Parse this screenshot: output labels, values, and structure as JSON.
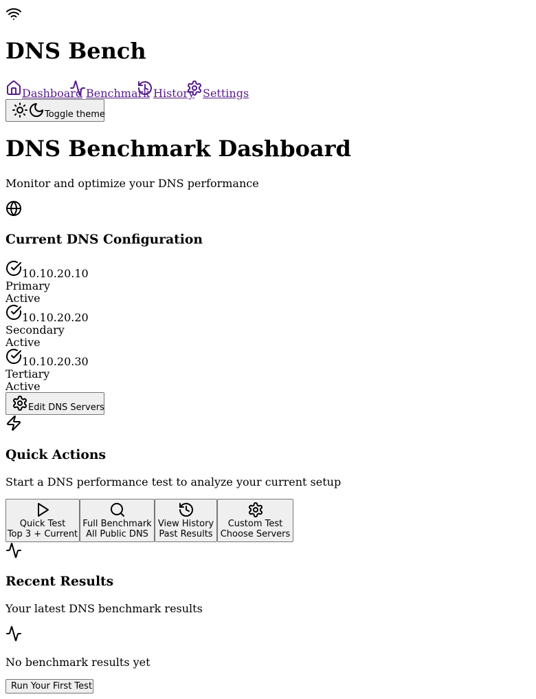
{
  "header": {
    "wifi_icon": "wifi-icon",
    "app_title": "DNS Bench",
    "nav": [
      {
        "label": "Dashboard",
        "icon": "home-icon"
      },
      {
        "label": "Benchmark",
        "icon": "activity-icon"
      },
      {
        "label": "History",
        "icon": "history-icon"
      },
      {
        "label": "Settings",
        "icon": "settings-icon"
      }
    ],
    "theme_toggle": {
      "label": "Toggle theme",
      "icons": [
        "sun-icon",
        "moon-icon"
      ]
    }
  },
  "page": {
    "title": "DNS Benchmark Dashboard",
    "subtitle": "Monitor and optimize your DNS performance"
  },
  "dns_config": {
    "icon": "globe-icon",
    "title": "Current DNS Configuration",
    "servers": [
      {
        "ip": "10.10.20.10",
        "role": "Primary",
        "status": "Active"
      },
      {
        "ip": "10.10.20.20",
        "role": "Secondary",
        "status": "Active"
      },
      {
        "ip": "10.10.20.30",
        "role": "Tertiary",
        "status": "Active"
      }
    ],
    "edit_button": "Edit DNS Servers"
  },
  "quick_actions": {
    "icon": "zap-icon",
    "title": "Quick Actions",
    "description": "Start a DNS performance test to analyze your current setup",
    "actions": [
      {
        "title": "Quick Test",
        "subtitle": "Top 3 + Current",
        "icon": "play-icon"
      },
      {
        "title": "Full Benchmark",
        "subtitle": "All Public DNS",
        "icon": "search-icon"
      },
      {
        "title": "View History",
        "subtitle": "Past Results",
        "icon": "history-icon"
      },
      {
        "title": "Custom Test",
        "subtitle": "Choose Servers",
        "icon": "settings-icon"
      }
    ]
  },
  "recent_results": {
    "icon": "activity-icon",
    "title": "Recent Results",
    "description": "Your latest DNS benchmark results",
    "empty_text": "No benchmark results yet",
    "run_button": "Run Your First Test"
  },
  "colors": {
    "link": "#551A8B",
    "button_bg": "#efefef",
    "button_border": "#767676"
  }
}
